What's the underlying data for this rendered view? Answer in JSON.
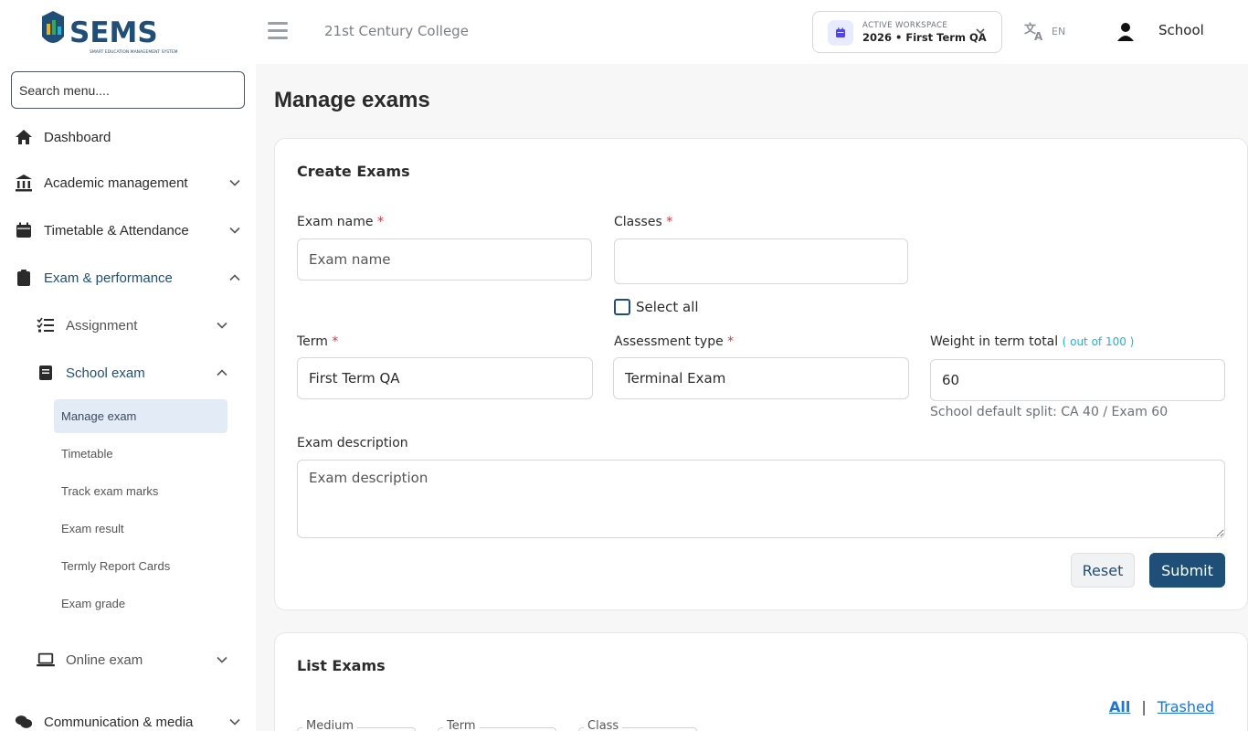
{
  "header": {
    "logo_alt": "SEMS",
    "college_name": "21st Century College",
    "workspace": {
      "caption": "ACTIVE WORKSPACE",
      "value": "2026 • First Term QA"
    },
    "language": "EN",
    "user": "School"
  },
  "sidebar": {
    "search_placeholder": "Search menu....",
    "items": [
      {
        "label": "Dashboard"
      },
      {
        "label": "Academic management"
      },
      {
        "label": "Timetable & Attendance"
      },
      {
        "label": "Exam & performance"
      },
      {
        "label": "Communication & media"
      }
    ],
    "sub_items": [
      {
        "label": "Assignment"
      },
      {
        "label": "School exam"
      },
      {
        "label": "Online exam"
      }
    ],
    "school_exam_links": [
      "Manage exam",
      "Timetable",
      "Track exam marks",
      "Exam result",
      "Termly Report Cards",
      "Exam grade"
    ]
  },
  "page": {
    "title": "Manage exams",
    "create": {
      "title": "Create Exams",
      "exam_name_label": "Exam name",
      "exam_name_placeholder": "Exam name",
      "classes_label": "Classes",
      "select_all": "Select all",
      "term_label": "Term",
      "term_value": "First Term QA",
      "assessment_label": "Assessment type",
      "assessment_value": "Terminal Exam",
      "weight_label": "Weight in term total",
      "weight_hint": "( out of 100 )",
      "weight_value": "60",
      "split_note": "School default split: CA 40 / Exam 60",
      "description_label": "Exam description",
      "description_placeholder": "Exam description",
      "reset": "Reset",
      "submit": "Submit",
      "required_mark": "*"
    },
    "list": {
      "title": "List Exams",
      "tab_all": "All",
      "separator": "|",
      "tab_trashed": "Trashed",
      "filters": [
        "Medium",
        "Term",
        "Class"
      ]
    }
  },
  "colors": {
    "primary": "#1f4e79",
    "link": "#1a73e8",
    "required": "#d9363e",
    "hint": "#19b5e2"
  }
}
